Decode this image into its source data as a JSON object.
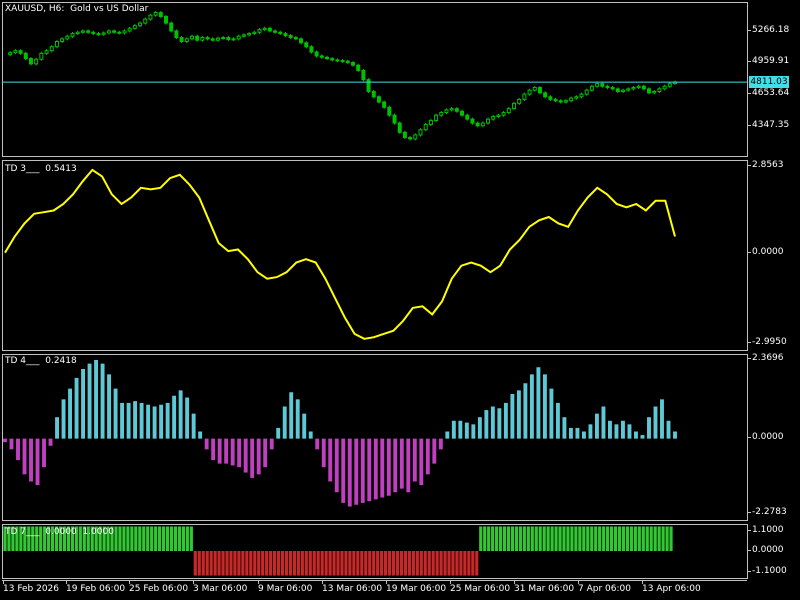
{
  "chart": {
    "symbol_title": "XAUUSD, H6:  Gold vs US Dollar",
    "current_price": "4811.03",
    "colors": {
      "background": "#000000",
      "frame": "#c0c0c0",
      "candle": "#00c000",
      "bid_line": "#40e0e8",
      "td3_line": "#ffff00",
      "td4_positive": "#5ec9d6",
      "td4_negative": "#c040c0",
      "td7_positive": "#32c832",
      "td7_negative": "#c82828"
    },
    "price_scale": [
      "5266.18",
      "4959.91",
      "4653.64",
      "4347.35"
    ],
    "dates": [
      "13 Feb 2026",
      "19 Feb 06:00",
      "25 Feb 06:00",
      "3 Mar 06:00",
      "9 Mar 06:00",
      "13 Mar 06:00",
      "19 Mar 06:00",
      "25 Mar 06:00",
      "31 Mar 06:00",
      "7 Apr 06:00",
      "13 Apr 06:00"
    ]
  },
  "indicators": {
    "td3": {
      "label": "TD 3___  0.5413",
      "scale": [
        "2.8563",
        "0.0000",
        "-2.9950"
      ]
    },
    "td4": {
      "label": "TD 4___  0.2418",
      "scale": [
        "2.3696",
        "0.0000",
        "-2.2783"
      ]
    },
    "td7": {
      "label": "TD 7___  0.0000  1.0000",
      "scale": [
        "1.1000",
        "0.0000",
        "-1.1000"
      ]
    }
  },
  "chart_data": {
    "type": "line",
    "title": "XAUUSD, H6:  Gold vs US Dollar",
    "ylim": [
      4250,
      5420
    ],
    "price_series": {
      "name": "XAUUSD",
      "values": [
        5020,
        5035,
        5050,
        5030,
        4990,
        4950,
        4985,
        5030,
        5050,
        5080,
        5120,
        5140,
        5160,
        5180,
        5190,
        5200,
        5190,
        5180,
        5175,
        5185,
        5200,
        5190,
        5185,
        5200,
        5220,
        5240,
        5260,
        5290,
        5320,
        5340,
        5310,
        5260,
        5200,
        5150,
        5120,
        5140,
        5160,
        5130,
        5150,
        5140,
        5130,
        5145,
        5150,
        5135,
        5140,
        5160,
        5170,
        5180,
        5190,
        5210,
        5220,
        5200,
        5190,
        5180,
        5165,
        5150,
        5140,
        5110,
        5080,
        5040,
        5010,
        5000,
        4990,
        4980,
        4975,
        4970,
        4960,
        4940,
        4900,
        4830,
        4740,
        4700,
        4660,
        4620,
        4560,
        4500,
        4430,
        4390,
        4380,
        4410,
        4450,
        4490,
        4520,
        4560,
        4580,
        4600,
        4610,
        4590,
        4560,
        4530,
        4500,
        4480,
        4500,
        4530,
        4550,
        4560,
        4580,
        4610,
        4650,
        4680,
        4720,
        4750,
        4770,
        4730,
        4700,
        4680,
        4670,
        4660,
        4670,
        4690,
        4700,
        4720,
        4750,
        4780,
        4800,
        4780,
        4770,
        4760,
        4740,
        4750,
        4760,
        4770,
        4780,
        4760,
        4730,
        4740,
        4760,
        4780,
        4800,
        4811
      ]
    },
    "td3": {
      "name": "TD 3",
      "ylim": [
        -2.995,
        2.8563
      ],
      "values": [
        0.0,
        0.5,
        0.9,
        1.2,
        1.25,
        1.3,
        1.5,
        1.8,
        2.2,
        2.55,
        2.35,
        1.8,
        1.5,
        1.7,
        2.0,
        1.95,
        2.0,
        2.3,
        2.4,
        2.1,
        1.7,
        1.0,
        0.3,
        0.05,
        0.1,
        -0.2,
        -0.6,
        -0.8,
        -0.75,
        -0.6,
        -0.3,
        -0.2,
        -0.3,
        -0.8,
        -1.4,
        -2.0,
        -2.5,
        -2.65,
        -2.6,
        -2.5,
        -2.4,
        -2.1,
        -1.7,
        -1.65,
        -1.9,
        -1.5,
        -0.8,
        -0.4,
        -0.3,
        -0.4,
        -0.6,
        -0.4,
        0.1,
        0.4,
        0.8,
        1.0,
        1.1,
        0.9,
        0.8,
        1.3,
        1.7,
        2.0,
        1.8,
        1.5,
        1.4,
        1.5,
        1.3,
        1.6,
        1.6,
        0.5
      ]
    },
    "td4": {
      "name": "TD 4",
      "ylim": [
        -2.2783,
        2.3696
      ],
      "values": [
        -0.1,
        -0.3,
        -0.6,
        -1.0,
        -1.2,
        -1.3,
        -0.8,
        -0.2,
        0.6,
        1.1,
        1.4,
        1.7,
        1.95,
        2.1,
        2.2,
        2.1,
        1.8,
        1.4,
        1.0,
        1.0,
        1.05,
        1.0,
        0.95,
        0.9,
        0.95,
        1.0,
        1.2,
        1.35,
        1.15,
        0.7,
        0.2,
        -0.3,
        -0.6,
        -0.7,
        -0.7,
        -0.75,
        -0.8,
        -0.95,
        -1.1,
        -1.0,
        -0.8,
        -0.3,
        0.3,
        0.9,
        1.3,
        1.1,
        0.7,
        0.2,
        -0.3,
        -0.8,
        -1.2,
        -1.5,
        -1.8,
        -1.9,
        -1.85,
        -1.8,
        -1.75,
        -1.7,
        -1.65,
        -1.6,
        -1.5,
        -1.4,
        -1.5,
        -1.2,
        -1.3,
        -1.0,
        -0.7,
        -0.3,
        0.2,
        0.5,
        0.5,
        0.45,
        0.4,
        0.6,
        0.8,
        0.9,
        0.85,
        1.0,
        1.25,
        1.35,
        1.55,
        1.8,
        2.0,
        1.8,
        1.4,
        1.0,
        0.6,
        0.3,
        0.3,
        0.2,
        0.4,
        0.7,
        0.9,
        0.5,
        0.4,
        0.5,
        0.4,
        0.2,
        0.1,
        0.6,
        0.9,
        1.1,
        0.5,
        0.2
      ]
    },
    "td7": {
      "name": "TD 7",
      "ylim": [
        -1.1,
        1.1
      ],
      "segments": [
        {
          "value": 1,
          "bars": 48
        },
        {
          "value": -1,
          "bars": 72
        },
        {
          "value": 1,
          "bars": 49
        }
      ]
    }
  }
}
